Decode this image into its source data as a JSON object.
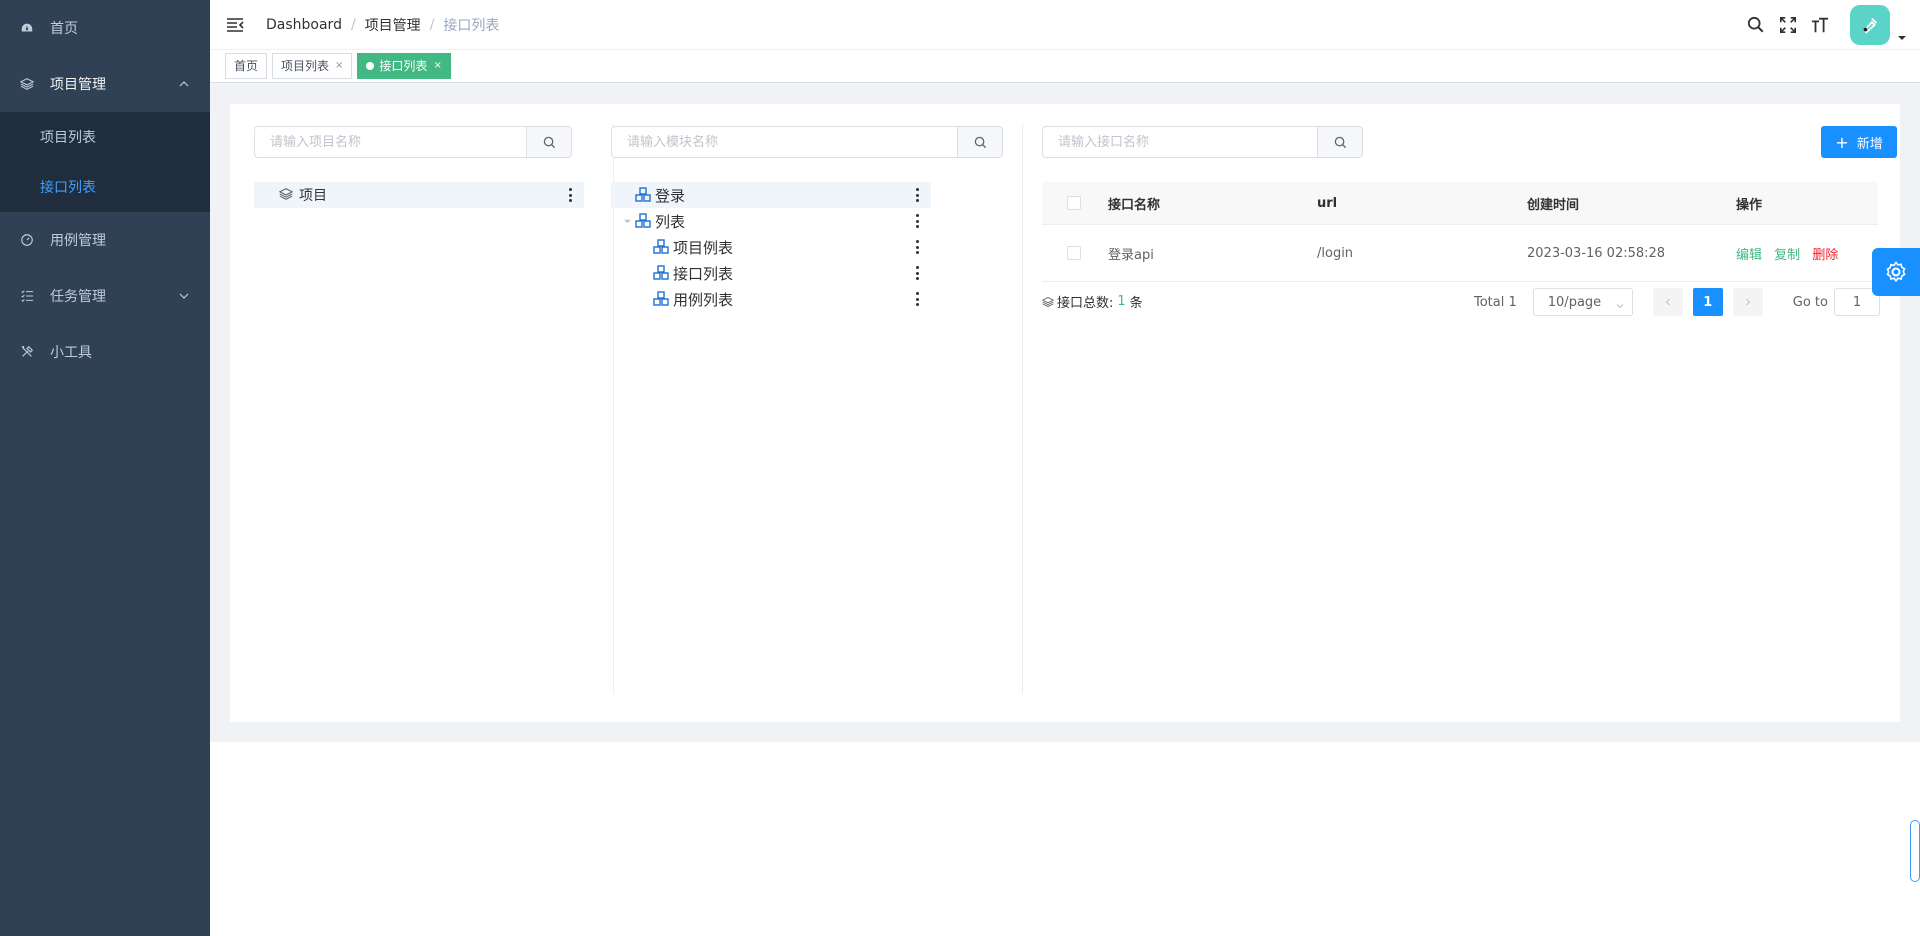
{
  "sidebar": {
    "items": [
      {
        "label": "首页",
        "icon": "dashboard-icon"
      },
      {
        "label": "项目管理",
        "icon": "layers-icon",
        "expanded": true,
        "children": [
          {
            "label": "项目列表"
          },
          {
            "label": "接口列表",
            "active": true
          }
        ]
      },
      {
        "label": "用例管理",
        "icon": "gauge-icon"
      },
      {
        "label": "任务管理",
        "icon": "task-list-icon"
      },
      {
        "label": "小工具",
        "icon": "tools-icon"
      }
    ]
  },
  "navbar": {
    "breadcrumb": [
      "Dashboard",
      "项目管理",
      "接口列表"
    ],
    "tools": [
      "search-icon",
      "fullscreen-icon",
      "font-size-icon"
    ]
  },
  "tags": [
    {
      "label": "首页",
      "closable": false,
      "active": false
    },
    {
      "label": "项目列表",
      "closable": true,
      "active": false
    },
    {
      "label": "接口列表",
      "closable": true,
      "active": true
    }
  ],
  "tag_close": "×",
  "panels": {
    "project_search": {
      "placeholder": "请输入项目名称"
    },
    "module_search": {
      "placeholder": "请输入模块名称"
    },
    "api_search": {
      "placeholder": "请输入接口名称"
    },
    "project_tree": [
      {
        "label": "项目",
        "selected": true
      }
    ],
    "module_tree": [
      {
        "label": "登录",
        "selected": true,
        "level": 0
      },
      {
        "label": "列表",
        "level": 0,
        "expanded": true
      },
      {
        "label": "项目例表",
        "level": 1
      },
      {
        "label": "接口列表",
        "level": 1
      },
      {
        "label": "用例列表",
        "level": 1
      }
    ]
  },
  "add_button": {
    "plus": "+",
    "label": "新增"
  },
  "table": {
    "headers": [
      "接口名称",
      "url",
      "创建时间",
      "操作"
    ],
    "rows": [
      {
        "name": "登录api",
        "url": "/login",
        "created": "2023-03-16 02:58:28",
        "actions": [
          "编辑",
          "复制",
          "删除"
        ]
      }
    ]
  },
  "summary": {
    "label": "接口总数:",
    "count": "1",
    "unit": "条"
  },
  "pagination": {
    "total": "Total 1",
    "page_size": "10/page",
    "current": "1",
    "goto_label": "Go to",
    "goto_value": "1"
  },
  "colors": {
    "sidebar_bg": "#304156",
    "accent": "#1890ff",
    "tag_active": "#42b983",
    "danger": "#f5222d"
  }
}
